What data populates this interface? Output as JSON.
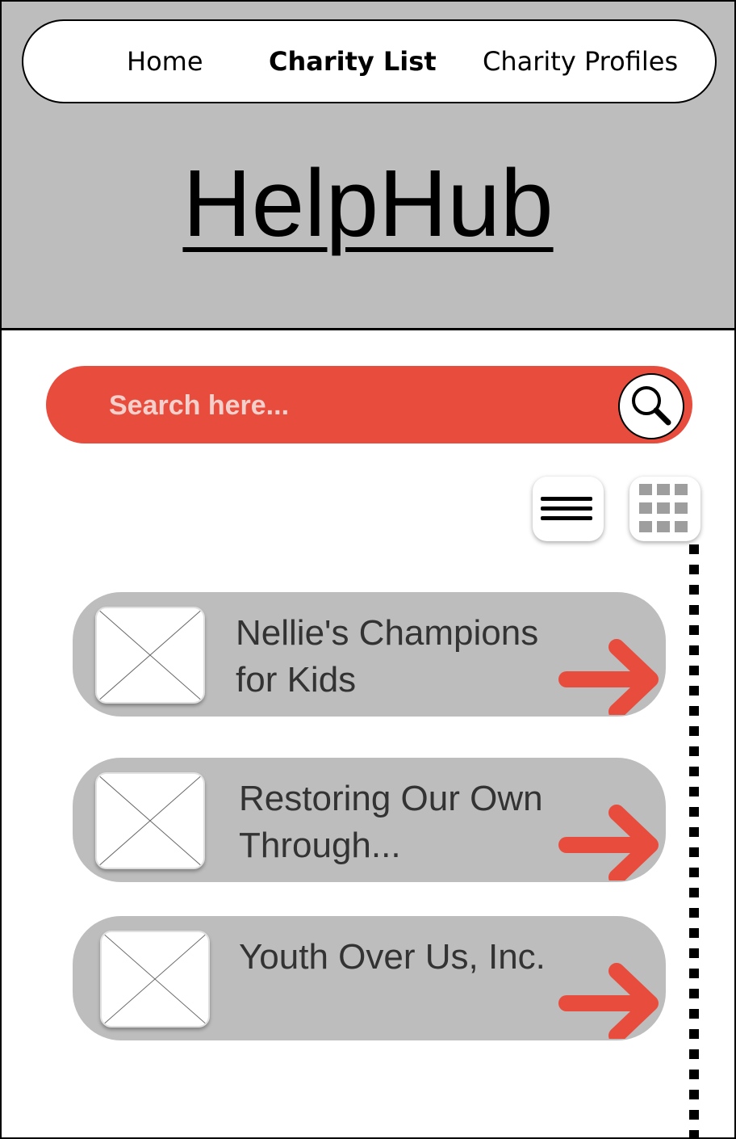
{
  "nav": {
    "items": [
      {
        "label": "Home",
        "active": false
      },
      {
        "label": "Charity List",
        "active": true
      },
      {
        "label": "Charity Profiles",
        "active": false
      }
    ]
  },
  "brand": {
    "title": "HelpHub"
  },
  "search": {
    "placeholder": "Search here...",
    "icon": "magnifier-icon"
  },
  "view_toggle": {
    "list_icon": "hamburger-list-icon",
    "grid_icon": "grid-icon"
  },
  "charities": [
    {
      "name": "Nellie's Champions for Kids",
      "image": "image-placeholder-icon",
      "action_icon": "arrow-right-icon"
    },
    {
      "name": "Restoring Our Own Through...",
      "image": "image-placeholder-icon",
      "action_icon": "arrow-right-icon"
    },
    {
      "name": "Youth Over Us, Inc.",
      "image": "image-placeholder-icon",
      "action_icon": "arrow-right-icon"
    }
  ],
  "colors": {
    "accent": "#e84c3d",
    "header_bg": "#bdbdbd",
    "card_bg": "#bdbdbd",
    "grid_icon": "#9e9e9e"
  }
}
